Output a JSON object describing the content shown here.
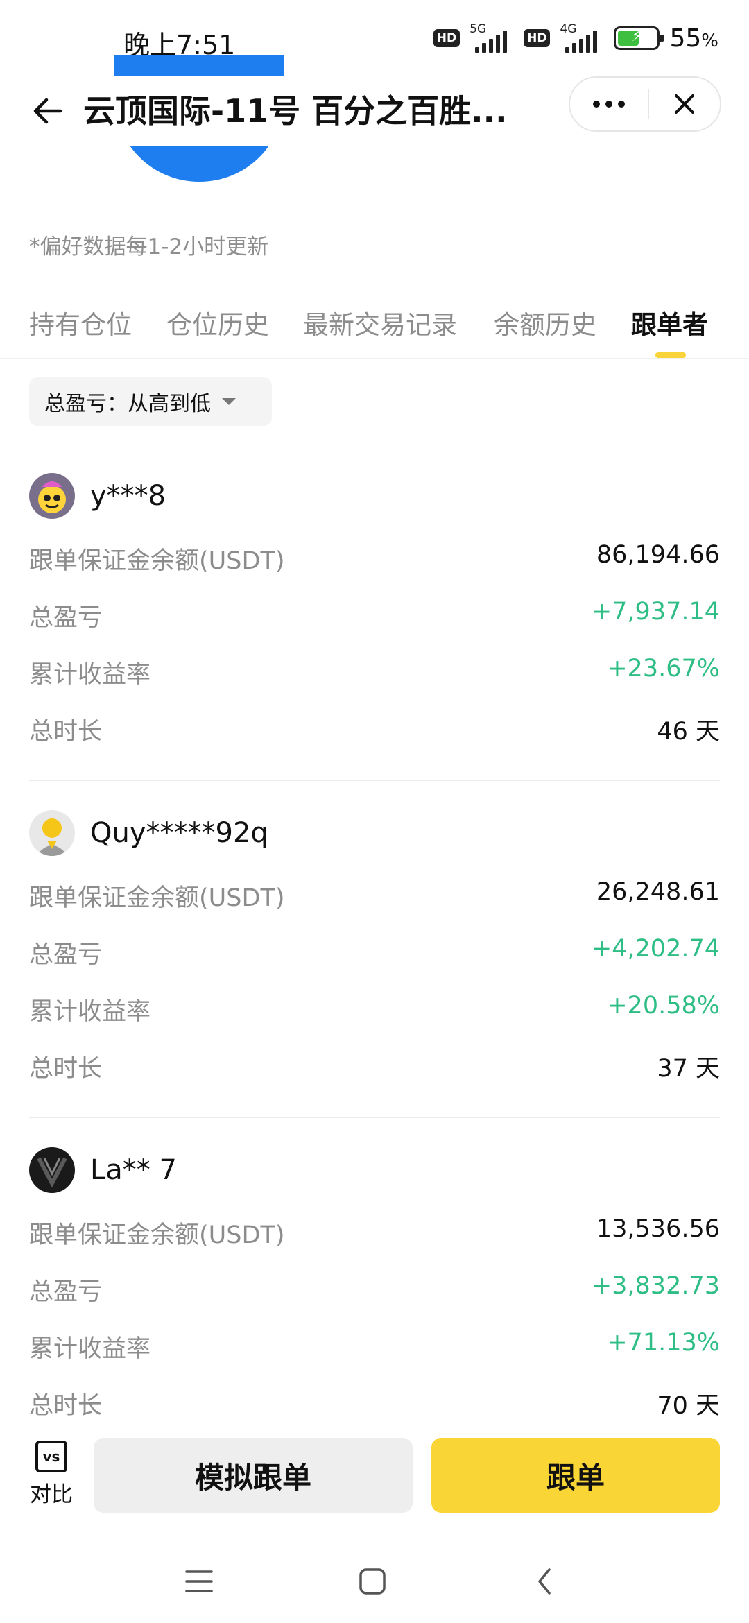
{
  "status_bar": {
    "time": "晚上7:51",
    "hd_badge_1": "HD",
    "network_1": "5G",
    "hd_badge_2": "HD",
    "network_2": "4G",
    "battery_percent": "55",
    "battery_unit": "%",
    "battery_level": 0.55,
    "battery_color": "#3fbf3f"
  },
  "header": {
    "title": "云顶国际-11号 百分之百胜...",
    "back_icon": "arrow-left-icon",
    "more_icon": "more-dots-icon",
    "close_icon": "close-icon"
  },
  "profile": {
    "avatar_color": "#1e7ef0"
  },
  "update_note": "*偏好数据每1-2小时更新",
  "tabs": [
    {
      "label": "持有仓位"
    },
    {
      "label": "仓位历史"
    },
    {
      "label": "最新交易记录"
    },
    {
      "label": "余额历史"
    },
    {
      "label": "跟单者"
    }
  ],
  "active_tab": "跟单者",
  "sort": {
    "label": "总盈亏：从高到低",
    "caret_icon": "caret-down-icon"
  },
  "followers": [
    {
      "name": "y***8",
      "rows": [
        {
          "label": "跟单保证金余额(USDT)",
          "value": "86,194.66"
        },
        {
          "label": "总盈亏",
          "value": "+7,937.14"
        },
        {
          "label": "累计收益率",
          "value": "+23.67%"
        },
        {
          "label": "总时长",
          "value": "46 天"
        }
      ]
    },
    {
      "name": "Quy*****92q",
      "rows": [
        {
          "label": "跟单保证金余额(USDT)",
          "value": "26,248.61"
        },
        {
          "label": "总盈亏",
          "value": "+4,202.74"
        },
        {
          "label": "累计收益率",
          "value": "+20.58%"
        },
        {
          "label": "总时长",
          "value": "37 天"
        }
      ]
    },
    {
      "name": "La** 7",
      "rows": [
        {
          "label": "跟单保证金余额(USDT)",
          "value": "13,536.56"
        },
        {
          "label": "总盈亏",
          "value": "+3,832.73"
        },
        {
          "label": "累计收益率",
          "value": "+71.13%"
        },
        {
          "label": "总时长",
          "value": "70 天"
        }
      ]
    }
  ],
  "bottom_bar": {
    "compare_icon_text": "vs",
    "compare_label": "对比",
    "simulate_label": "模拟跟单",
    "follow_label": "跟单",
    "follow_color": "#f9d535"
  },
  "colors": {
    "accent": "#f8d33a",
    "profit_green": "#2dbd85",
    "muted_text": "#8c8c8c"
  },
  "system_nav": {
    "menu_icon": "menu-icon",
    "home_icon": "home-square-icon",
    "back_icon": "back-chevron-icon"
  }
}
